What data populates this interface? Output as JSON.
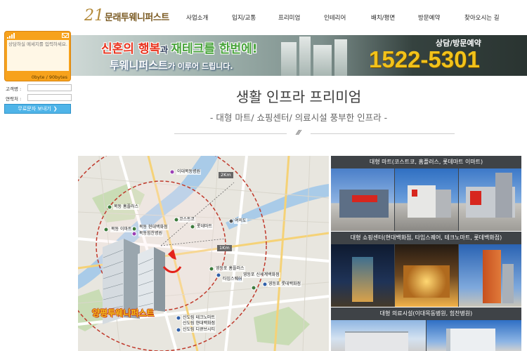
{
  "header": {
    "logo_mark": "21",
    "logo_text": "문래투웨니퍼스트",
    "nav": [
      {
        "label": "사업소개"
      },
      {
        "label": "입지/교통"
      },
      {
        "label": "프리미엄"
      },
      {
        "label": "인테리어"
      },
      {
        "label": "배치/평면"
      },
      {
        "label": "방문예약"
      },
      {
        "label": "찾아오시는 길"
      }
    ]
  },
  "banner": {
    "line1_a": "신혼의 행복",
    "line1_b": "과 ",
    "line1_c": "재테크를 한번에!",
    "line2_a": "투웨니퍼스트",
    "line2_b": "가 이루어 드립니다.",
    "reserve_label": "상담/방문예약",
    "phone": "1522-5301"
  },
  "sms": {
    "placeholder": "상담하실 메세지를 입력하세요.",
    "byte_count": "0byte / 90bytes",
    "name_label": "고객명 :",
    "phone_label": "연락처 :",
    "send_label": "무료문자 보내기",
    "send_chevron": "❯"
  },
  "section": {
    "title": "생활 인프라 프리미엄",
    "subtitle": "- 대형 마트/ 쇼핑센터/ 의료시설 풍부한 인프라 -",
    "ornament": "⁄⁄⁄"
  },
  "map": {
    "apartment_name": "양평투웨니퍼스트",
    "km2": "2Km",
    "km1": "1Km",
    "labels": [
      {
        "text": "이대목동병원"
      },
      {
        "text": "목동 홈플러스"
      },
      {
        "text": "목동 현대백화점"
      },
      {
        "text": "목동 이마트"
      },
      {
        "text": "목동힘찬병원"
      },
      {
        "text": "코스트코"
      },
      {
        "text": "롯데마트"
      },
      {
        "text": "영등포 롯데백화점"
      },
      {
        "text": "영등포 신세계백화점"
      },
      {
        "text": "타임스퀘어"
      },
      {
        "text": "영등포 홈플러스"
      },
      {
        "text": "신도림 테크노마트"
      },
      {
        "text": "신도림 현대백화점"
      },
      {
        "text": "신도림 디큐브시티"
      },
      {
        "text": "여의도"
      }
    ]
  },
  "panels": [
    {
      "title": "대형 마트(코스트코, 홈플러스, 롯데마트 이마트)"
    },
    {
      "title": "대형 쇼핑센터(현대백화점, 타임스퀘어, 테크노마트, 롯데백화점)"
    },
    {
      "title": "대형 의료시설(이대목동병원, 힘찬병원)"
    }
  ],
  "colors": {
    "accent_orange": "#f7a21c",
    "phone_yellow": "#f2c21a",
    "send_blue": "#4fb4e8",
    "banner_red": "#e8331e"
  }
}
